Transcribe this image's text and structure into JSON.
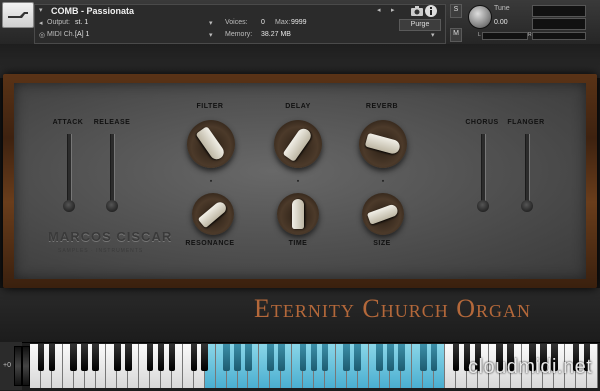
{
  "header": {
    "instrument_name": "COMB - Passionata",
    "output_label": "Output:",
    "output_value": "st. 1",
    "voices_label": "Voices:",
    "voices_value": "0",
    "max_label": "Max:",
    "max_value": "9999",
    "purge_label": "Purge",
    "midi_label": "MIDI Ch.:",
    "midi_value": "[A]  1",
    "memory_label": "Memory:",
    "memory_value": "38.27 MB",
    "s_label": "S",
    "m_label": "M",
    "tune_label": "Tune",
    "tune_value": "0.00",
    "pan_l": "L",
    "pan_r": "R",
    "prev_arrow": "◂",
    "next_arrow": "▸",
    "camera_icon": "camera-icon",
    "info_icon": "info-icon"
  },
  "panel": {
    "sliders": {
      "attack": "ATTACK",
      "release": "RELEASE",
      "chorus": "CHORUS",
      "flanger": "FLANGER"
    },
    "knobs": {
      "filter": "FILTER",
      "delay": "DELAY",
      "reverb": "REVERB",
      "resonance": "RESONANCE",
      "time": "TIME",
      "size": "SIZE"
    },
    "brand": "MARCOS CISCAR",
    "brand_sub": "SAMPLES · INSTRUMENTS",
    "product_title": "Eternity Church Organ"
  },
  "keyboard": {
    "octave_label": "+0",
    "watermark": "cloudmidi.net"
  }
}
